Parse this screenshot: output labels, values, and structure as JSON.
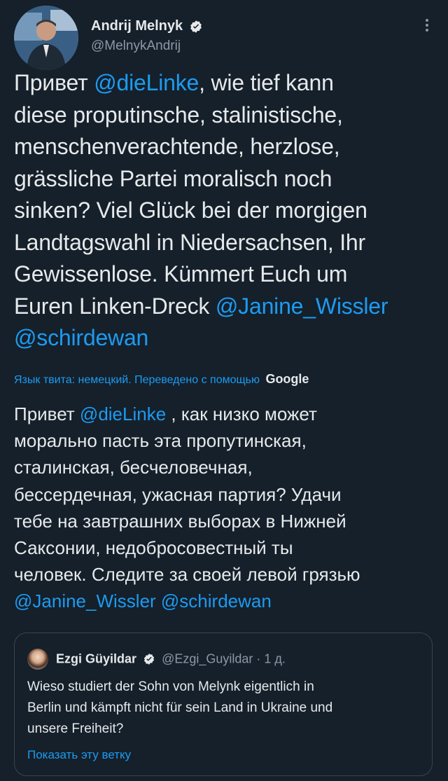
{
  "author": {
    "display_name": "Andrij Melnyk",
    "handle": "@MelnykAndrij"
  },
  "tweet": {
    "lines": [
      {
        "pre": "Привет ",
        "mention": "@dieLinke",
        "post": ", wie tief kann"
      },
      {
        "pre": "diese proputinsche, stalinistische,",
        "mention": "",
        "post": ""
      },
      {
        "pre": "menschenverachtende, herzlose,",
        "mention": "",
        "post": ""
      },
      {
        "pre": "grässliche Partei moralisch noch",
        "mention": "",
        "post": ""
      },
      {
        "pre": "sinken? Viel Glück bei der morgigen",
        "mention": "",
        "post": ""
      },
      {
        "pre": "Landtagswahl in Niedersachsen, Ihr",
        "mention": "",
        "post": ""
      },
      {
        "pre": "Gewissenlose. Kümmert Euch um",
        "mention": "",
        "post": ""
      },
      {
        "pre": "Euren Linken-Dreck ",
        "mention": "@Janine_Wissler",
        "post": ""
      },
      {
        "pre": "",
        "mention": "@schirdewan",
        "post": ""
      }
    ]
  },
  "translation": {
    "label": "Язык твита: немецкий. Переведено с помощью",
    "provider": "Google",
    "lines": [
      {
        "pre": "Привет ",
        "mention": "@dieLinke",
        "post": " , как низко может"
      },
      {
        "pre": "морально пасть эта пропутинская,",
        "mention": "",
        "post": ""
      },
      {
        "pre": "сталинская, бесчеловечная,",
        "mention": "",
        "post": ""
      },
      {
        "pre": "бессердечная, ужасная партия? Удачи",
        "mention": "",
        "post": ""
      },
      {
        "pre": "тебе на завтрашних выборах в Нижней",
        "mention": "",
        "post": ""
      },
      {
        "pre": "Саксонии, недобросовестный ты",
        "mention": "",
        "post": ""
      },
      {
        "pre": "человек. Следите за своей левой грязью",
        "mention": "",
        "post": ""
      },
      {
        "pre": "",
        "mention": "@Janine_Wissler @schirdewan",
        "post": ""
      }
    ]
  },
  "quoted_tweet": {
    "display_name": "Ezgi Güyildar",
    "handle": "@Ezgi_Guyildar",
    "time": "· 1 д.",
    "lines": [
      "Wieso studiert der Sohn von Melynk eigentlich in",
      "Berlin und kämpft nicht für sein Land in Ukraine und",
      "unsere Freiheit?"
    ],
    "show_thread": "Показать эту ветку"
  },
  "colors": {
    "background": "#15202b",
    "text": "#e7e9ea",
    "link": "#1d9bf0",
    "muted": "#8b98a5",
    "verified": "#1d9bf0"
  }
}
